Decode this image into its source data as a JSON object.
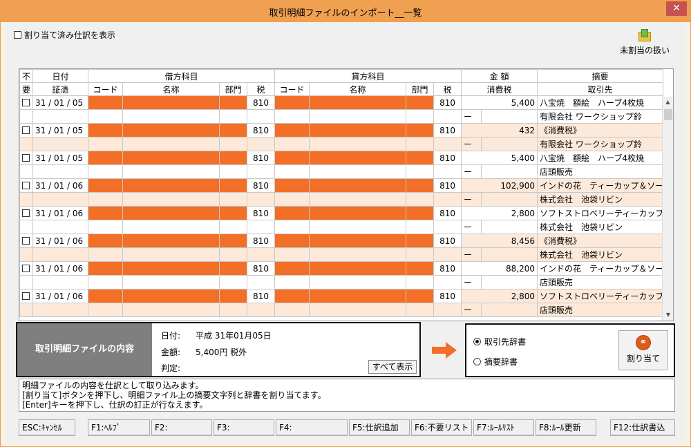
{
  "window": {
    "title": "取引明細ファイルのインポート__一覧",
    "close_glyph": "✕"
  },
  "toolbar": {
    "show_assigned_label": "割り当て済み仕訳を表示",
    "unassigned_label": "未割当の扱い"
  },
  "grid": {
    "header_top": {
      "unnecessary_1": "不",
      "date": "日付",
      "debit": "借方科目",
      "credit": "貸方科目",
      "amount": "金 額",
      "summary": "摘要"
    },
    "header_bottom": {
      "unnecessary_2": "要",
      "voucher": "証憑",
      "debit_code": "コード",
      "debit_name": "名称",
      "debit_dept": "部門",
      "debit_tax": "税",
      "credit_code": "コード",
      "credit_name": "名称",
      "credit_dept": "部門",
      "credit_tax": "税",
      "consumption_tax": "消費税",
      "partner": "取引先"
    },
    "rows": [
      {
        "date": "31 / 01 / 05",
        "debit_tax": "810",
        "credit_tax": "810",
        "amount": "5,400",
        "summary": "八宝焼　額絵　ハーブ4枚焼",
        "tax_sign": "ー",
        "partner": "有限会社 ワークショップ鈴",
        "band": "w"
      },
      {
        "date": "31 / 01 / 05",
        "debit_tax": "810",
        "credit_tax": "810",
        "amount": "432",
        "summary": "《消費税》",
        "tax_sign": "ー",
        "partner": "有限会社 ワークショップ鈴",
        "band": "p"
      },
      {
        "date": "31 / 01 / 05",
        "debit_tax": "810",
        "credit_tax": "810",
        "amount": "5,400",
        "summary": "八宝焼　額絵　ハーブ4枚焼",
        "tax_sign": "ー",
        "partner": "店頭販売",
        "band": "w"
      },
      {
        "date": "31 / 01 / 06",
        "debit_tax": "810",
        "credit_tax": "810",
        "amount": "102,900",
        "summary": "インドの花　ティーカップ＆ソーサ",
        "tax_sign": "ー",
        "partner": "株式会社　池袋リビン",
        "band": "p"
      },
      {
        "date": "31 / 01 / 06",
        "debit_tax": "810",
        "credit_tax": "810",
        "amount": "2,800",
        "summary": "ソフトストロベリーティーカップ＆ソ",
        "tax_sign": "ー",
        "partner": "株式会社　池袋リビン",
        "band": "w"
      },
      {
        "date": "31 / 01 / 06",
        "debit_tax": "810",
        "credit_tax": "810",
        "amount": "8,456",
        "summary": "《消費税》",
        "tax_sign": "ー",
        "partner": "株式会社　池袋リビン",
        "band": "p"
      },
      {
        "date": "31 / 01 / 06",
        "debit_tax": "810",
        "credit_tax": "810",
        "amount": "88,200",
        "summary": "インドの花　ティーカップ＆ソーサ",
        "tax_sign": "ー",
        "partner": "店頭販売",
        "band": "w"
      },
      {
        "date": "31 / 01 / 06",
        "debit_tax": "810",
        "credit_tax": "810",
        "amount": "2,800",
        "summary": "ソフトストロベリーティーカップ＆ソ",
        "tax_sign": "ー",
        "partner": "店頭販売",
        "band": "p"
      }
    ]
  },
  "info": {
    "title": "取引明細ファイルの内容",
    "date_label": "日付:",
    "date_value": "平成 31年01月05日",
    "amount_label": "金額:",
    "amount_value": "5,400円 税外",
    "judge_label": "判定:",
    "show_all": "すべて表示"
  },
  "dict": {
    "partner_dict": "取引先辞書",
    "summary_dict": "摘要辞書",
    "assign_button": "割り当て"
  },
  "messages": [
    "明細ファイルの内容を仕訳として取り込みます。",
    "[割り当て]ボタンを押下し、明細ファイル上の摘要文字列と辞書を割り当てます。",
    "[Enter]キーを押下し、仕訳の訂正が行なえます。"
  ],
  "fkeys": {
    "esc": "ESC:ｷｬﾝｾﾙ",
    "f1": "F1:ﾍﾙﾌﾟ",
    "f2": "F2:",
    "f3": "F3:",
    "f4": "F4:",
    "f5": "F5:仕訳追加",
    "f6": "F6:不要リスト",
    "f7": "F7:ﾙｰﾙﾘｽﾄ",
    "f8": "F8:ﾙｰﾙ更新",
    "f12": "F12:仕訳書込"
  },
  "colors": {
    "accent": "#f0a050",
    "masked": "#f36f27",
    "band": "#fde9d9"
  }
}
